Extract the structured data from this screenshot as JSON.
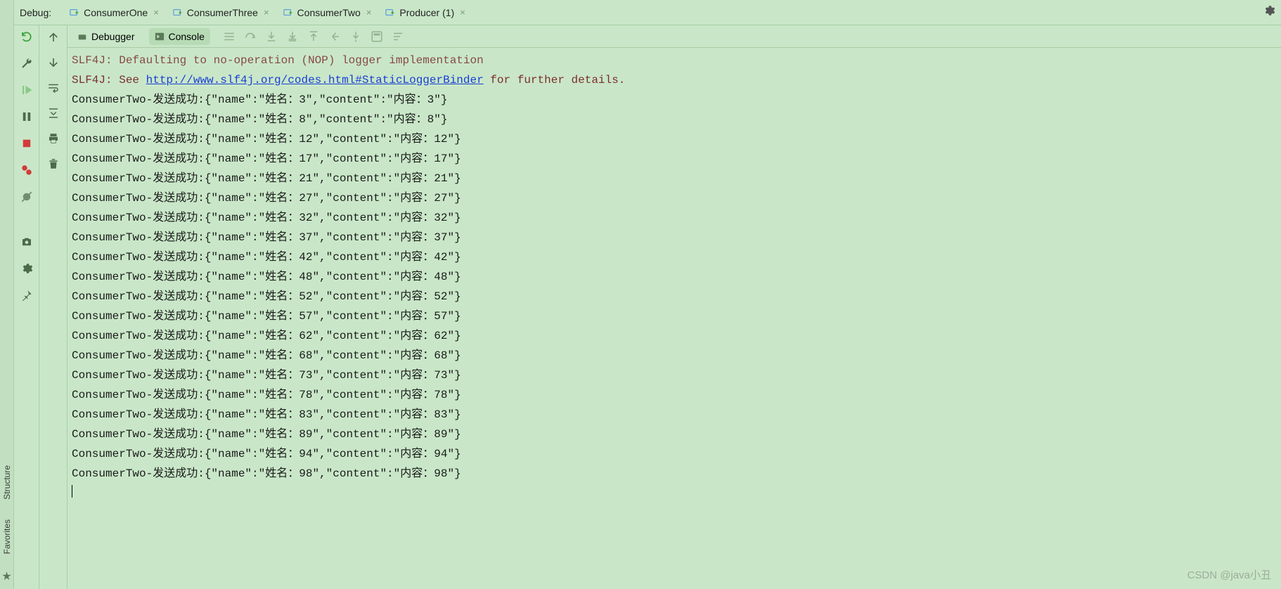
{
  "header": {
    "title": "Debug:",
    "tabs": [
      {
        "label": "ConsumerOne"
      },
      {
        "label": "ConsumerThree"
      },
      {
        "label": "ConsumerTwo"
      },
      {
        "label": "Producer (1)"
      }
    ]
  },
  "left_vertical_tabs": [
    {
      "label": "Structure"
    },
    {
      "label": "Favorites"
    }
  ],
  "left_icons": {
    "rerun": "rerun-icon",
    "fix": "wrench-icon",
    "resume": "resume-icon",
    "pause": "pause-icon",
    "stop": "stop-icon",
    "breakpoints": "view-breakpoints-icon",
    "mute": "mute-breakpoints-icon",
    "camera": "camera-icon",
    "settings": "settings-icon",
    "pin": "pin-icon"
  },
  "nav_icons": {
    "up": "arrow-up-icon",
    "down": "arrow-down-icon",
    "filter": "filter-icon",
    "wrap": "soft-wrap-icon",
    "print": "print-icon",
    "trash": "trash-icon"
  },
  "sub_tabs": {
    "debugger": "Debugger",
    "console": "Console"
  },
  "toolbar_icons": [
    "threads-icon",
    "step-over-icon",
    "step-into-icon",
    "force-step-into-icon",
    "step-out-icon",
    "return-icon",
    "run-to-cursor-icon",
    "calc-icon",
    "list-icon"
  ],
  "console_log": {
    "cut_line": "SLF4J: Defaulting to no-operation (NOP) logger implementation",
    "slf_prefix": "SLF4J: See ",
    "url": "http://www.slf4j.org/codes.html#StaticLoggerBinder",
    "slf_suffix": " for further details.",
    "consumer": "ConsumerTwo",
    "sent_label": "发送成功",
    "name_key": "name",
    "name_label": "姓名：",
    "content_key": "content",
    "content_label": "内容：",
    "ids": [
      3,
      8,
      12,
      17,
      21,
      27,
      32,
      37,
      42,
      48,
      52,
      57,
      62,
      68,
      73,
      78,
      83,
      89,
      94,
      98
    ]
  },
  "watermark": "CSDN @java小丑"
}
